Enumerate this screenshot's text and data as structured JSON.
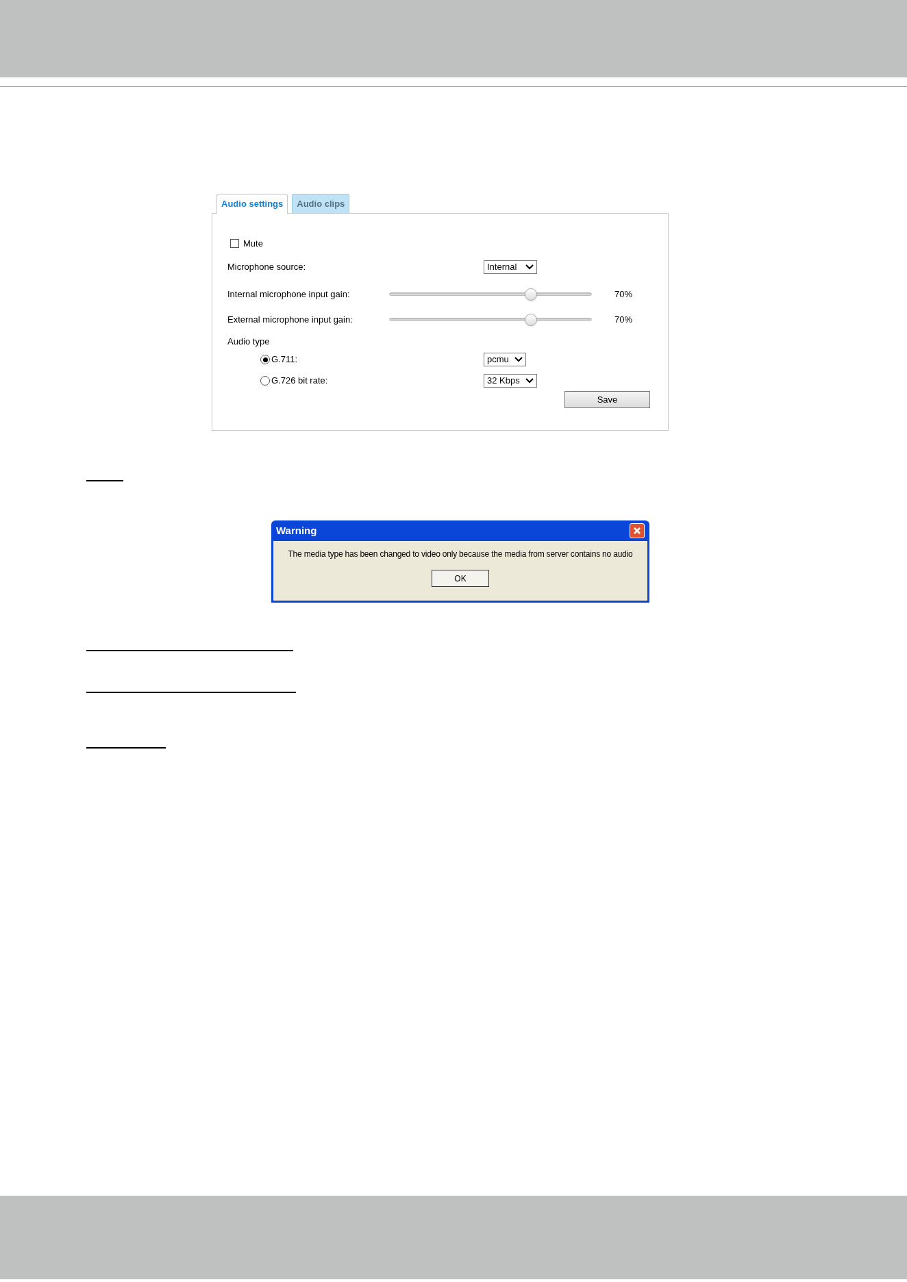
{
  "tabs": [
    {
      "label": "Audio settings",
      "selected": true
    },
    {
      "label": "Audio clips",
      "selected": false
    }
  ],
  "mute": {
    "label": "Mute",
    "checked": false
  },
  "microphone_source": {
    "label": "Microphone source:",
    "value": "Internal"
  },
  "gains": [
    {
      "label": "Internal microphone input gain:",
      "level": 0.7,
      "reading": "70%"
    },
    {
      "label": "External microphone input gain:",
      "level": 0.7,
      "reading": "70%"
    }
  ],
  "audio_type": {
    "label": "Audio type",
    "options": [
      {
        "label": "G.711:",
        "selected": true,
        "value": "pcmu"
      },
      {
        "label": "G.726 bit rate:",
        "selected": false,
        "value": "32 Kbps"
      }
    ]
  },
  "save_button": "Save",
  "warning_dialog": {
    "title": "Warning",
    "message": "The media type has been changed to video only because the media from server contains no audio",
    "button": "OK"
  }
}
